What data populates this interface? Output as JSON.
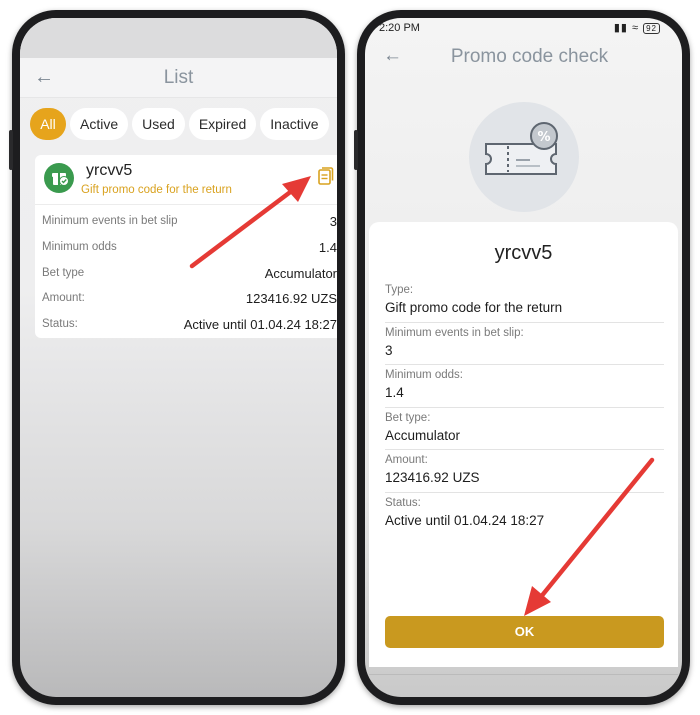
{
  "left_screen": {
    "header": {
      "title": "List",
      "back_icon": "arrow-left-icon"
    },
    "filters": [
      {
        "label": "All",
        "active": true
      },
      {
        "label": "Active",
        "active": false
      },
      {
        "label": "Used",
        "active": false
      },
      {
        "label": "Expired",
        "active": false
      },
      {
        "label": "Inactive",
        "active": false
      }
    ],
    "card": {
      "code": "yrcvv5",
      "subtitle": "Gift promo code for the return",
      "rows": [
        {
          "key": "Minimum events in bet slip",
          "value": "3"
        },
        {
          "key": "Minimum odds",
          "value": "1.4"
        },
        {
          "key": "Bet type",
          "value": "Accumulator"
        },
        {
          "key": "Amount:",
          "value": "123416.92 UZS"
        },
        {
          "key": "Status:",
          "value": "Active until 01.04.24 18:27"
        }
      ]
    }
  },
  "right_screen": {
    "status_bar": {
      "time": "2:20 PM",
      "battery": "92"
    },
    "header": {
      "title": "Promo code check",
      "back_icon": "arrow-left-icon"
    },
    "code": "yrcvv5",
    "fields": [
      {
        "key": "Type:",
        "value": "Gift promo code for the return"
      },
      {
        "key": "Minimum events in bet slip:",
        "value": "3"
      },
      {
        "key": "Minimum odds:",
        "value": "1.4"
      },
      {
        "key": "Bet type:",
        "value": "Accumulator"
      },
      {
        "key": "Amount:",
        "value": "123416.92 UZS"
      },
      {
        "key": "Status:",
        "value": "Active until 01.04.24 18:27"
      }
    ],
    "ok_label": "OK"
  },
  "colors": {
    "accent": "#e6a41c",
    "ok_button": "#c9991f",
    "subtitle_gold": "#d9a21f",
    "gift_green": "#3a9a4e",
    "annotation_red": "#e53a35"
  }
}
